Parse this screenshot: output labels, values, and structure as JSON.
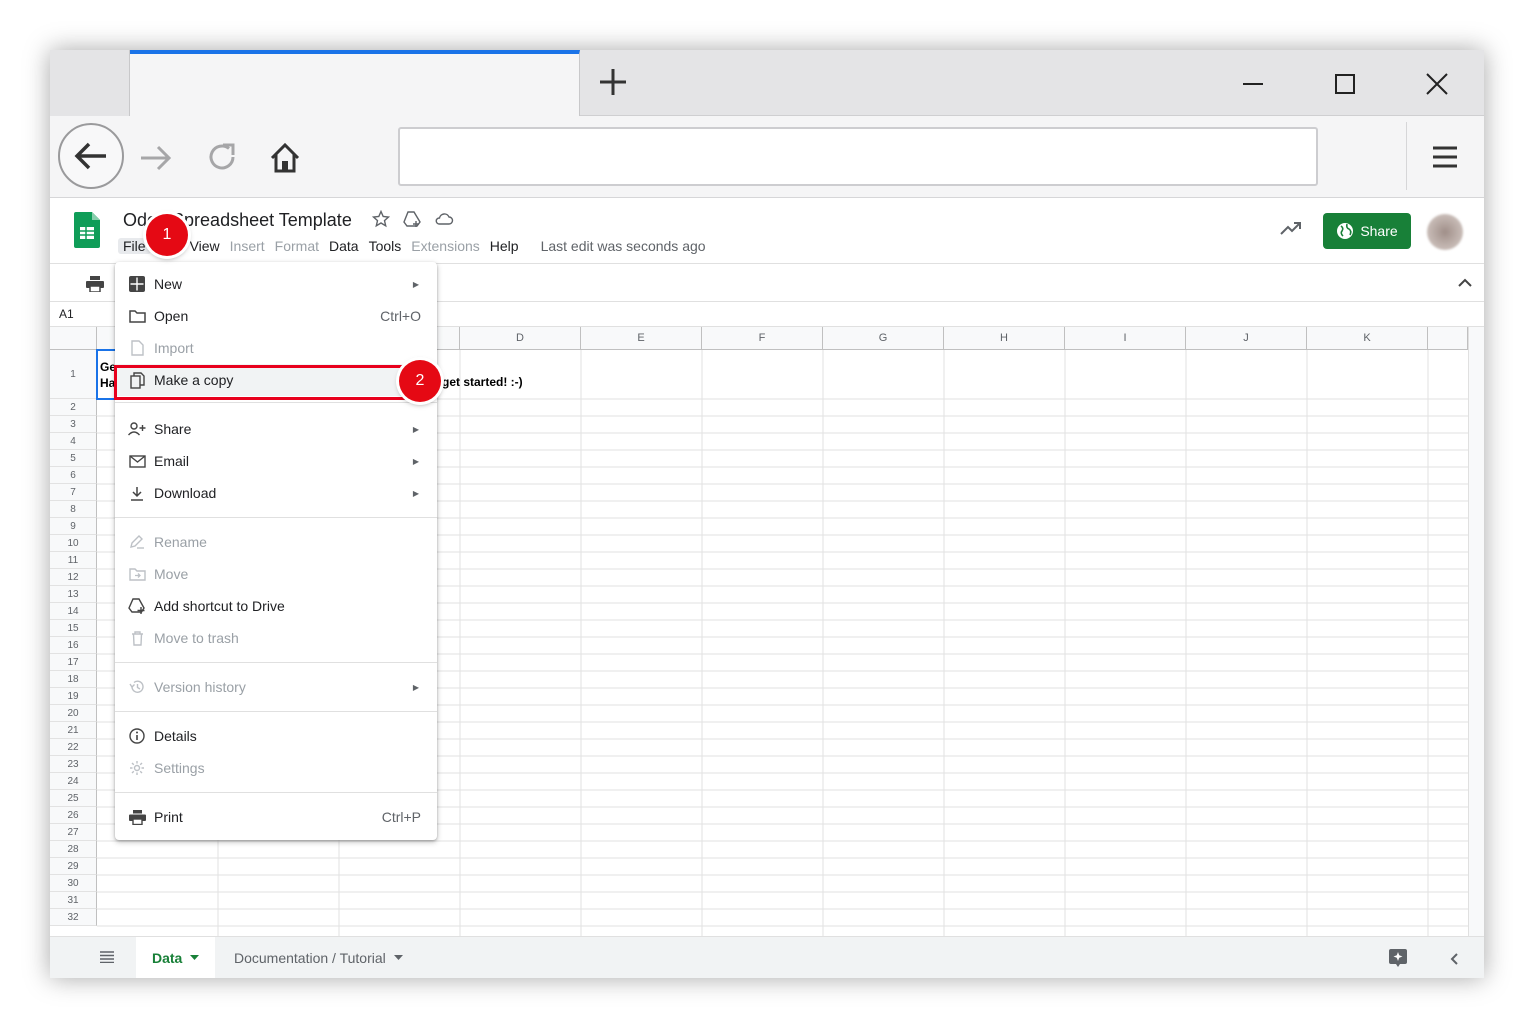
{
  "browser": {
    "new_tab_icon": "plus-icon",
    "window_controls": [
      "minimize-icon",
      "maximize-icon",
      "close-icon"
    ],
    "nav_icons": [
      "back-arrow-icon",
      "forward-arrow-icon",
      "reload-icon",
      "home-icon",
      "hamburger-menu-icon"
    ],
    "url": ""
  },
  "sheets": {
    "title": "Odoo Spreadsheet Template",
    "menu": {
      "file": "File",
      "view": "View",
      "insert": "Insert",
      "format": "Format",
      "data": "Data",
      "tools": "Tools",
      "extensions": "Extensions",
      "help": "Help"
    },
    "last_edit": "Last edit was seconds ago",
    "share_label": "Share",
    "accent_color": "#188038"
  },
  "formula_bar": {
    "cell_ref": "A1"
  },
  "grid": {
    "columns": [
      "D",
      "E",
      "F",
      "G",
      "H",
      "I",
      "J",
      "K"
    ],
    "rows": [
      "1",
      "2",
      "3",
      "4",
      "5",
      "6",
      "7",
      "8",
      "9",
      "10",
      "11",
      "12",
      "13",
      "14",
      "15",
      "16",
      "17",
      "18",
      "19",
      "20",
      "21",
      "22",
      "23",
      "24",
      "25",
      "26",
      "27",
      "28",
      "29",
      "30",
      "31",
      "32"
    ],
    "a1_line1": "Ge",
    "a1_line2": "Ha",
    "c1_text": "get started! :-)"
  },
  "file_menu": {
    "new": "New",
    "open": "Open",
    "open_shortcut": "Ctrl+O",
    "import": "Import",
    "make_copy": "Make a copy",
    "share": "Share",
    "email": "Email",
    "download": "Download",
    "rename": "Rename",
    "move": "Move",
    "add_shortcut": "Add shortcut to Drive",
    "move_trash": "Move to trash",
    "version_history": "Version history",
    "details": "Details",
    "settings": "Settings",
    "print": "Print",
    "print_shortcut": "Ctrl+P"
  },
  "sheet_tabs": {
    "data": "Data",
    "documentation": "Documentation / Tutorial"
  },
  "annotations": {
    "step1": "1",
    "step2": "2",
    "highlight_color": "#e8001c"
  }
}
